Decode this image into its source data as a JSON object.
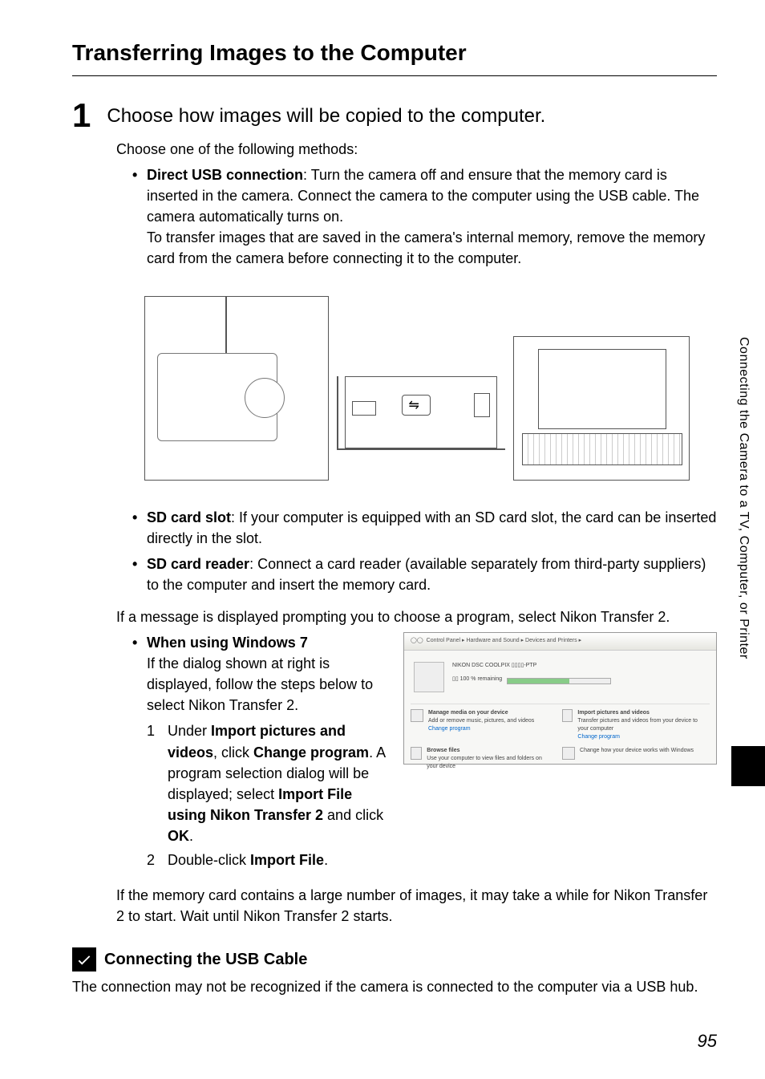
{
  "heading": "Transferring Images to the Computer",
  "step": {
    "number": "1",
    "title": "Choose how images will be copied to the computer.",
    "intro": "Choose one of the following methods:",
    "bullets": {
      "usb": {
        "label": "Direct USB connection",
        "text1": ": Turn the camera off and ensure that the memory card is inserted in the camera. Connect the camera to the computer using the USB cable. The camera automatically turns on.",
        "text2": "To transfer images that are saved in the camera's internal memory, remove the memory card from the camera before connecting it to the computer."
      },
      "sdslot": {
        "label": "SD card slot",
        "text": ": If your computer is equipped with an SD card slot, the card can be inserted directly in the slot."
      },
      "sdreader": {
        "label": "SD card reader",
        "text": ": Connect a card reader (available separately from third-party suppliers) to the computer and insert the memory card."
      }
    },
    "para_program": "If a message is displayed prompting you to choose a program, select Nikon Transfer 2.",
    "win7": {
      "label": "When using Windows 7",
      "text": "If the dialog shown at right is displayed, follow the steps below to select Nikon Transfer 2.",
      "steps": {
        "s1a": "Under ",
        "s1b": "Import pictures and videos",
        "s1c": ", click ",
        "s1d": "Change program",
        "s1e": ". A program selection dialog will be displayed; select ",
        "s1f": "Import File using Nikon Transfer 2",
        "s1g": " and click ",
        "s1h": "OK",
        "s1i": ".",
        "s2a": "Double-click ",
        "s2b": "Import File",
        "s2c": "."
      }
    },
    "para_wait": "If the memory card contains a large number of images, it may take a while for Nikon Transfer 2 to start. Wait until Nikon Transfer 2 starts."
  },
  "win7_dialog": {
    "breadcrumb": "Control Panel  ▸  Hardware and Sound  ▸  Devices and Printers  ▸",
    "device": "NIKON DSC COOLPIX ▯▯▯▯-PTP",
    "remaining": "▯▯ 100 % remaining",
    "action1_title": "Manage media on your device",
    "action1_sub": "Add or remove music, pictures, and videos",
    "action1_link": "Change program",
    "action2_title": "Import pictures and videos",
    "action2_sub": "Transfer pictures and videos from your device to your computer",
    "action2_link": "Change program",
    "browse_title": "Browse files",
    "browse_sub": "Use your computer to view files and folders on your device",
    "change_sub": "Change how your device works with Windows"
  },
  "note": {
    "title": "Connecting the USB Cable",
    "body": "The connection may not be recognized if the camera is connected to the computer via a USB hub."
  },
  "side_text": "Connecting the Camera to a TV, Computer, or Printer",
  "page_number": "95"
}
